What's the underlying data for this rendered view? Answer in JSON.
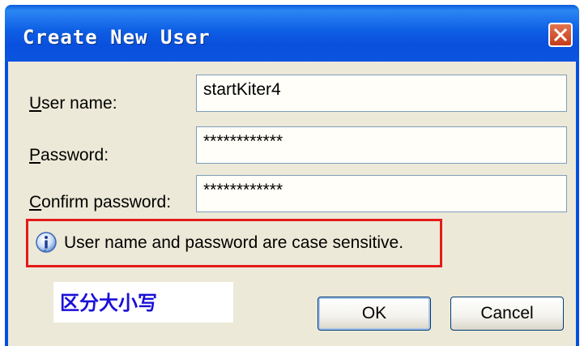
{
  "window": {
    "title": "Create New User"
  },
  "form": {
    "username": {
      "label_first": "U",
      "label_rest": "ser name:",
      "value": "startKiter4"
    },
    "password": {
      "label_first": "P",
      "label_rest": "assword:",
      "value": "************"
    },
    "confirm": {
      "label_first": "C",
      "label_rest": "onfirm password:",
      "value": "************"
    }
  },
  "notice": {
    "icon": "info-icon",
    "text": "User name and password are case sensitive.",
    "highlight_color": "#e41a1a"
  },
  "annotation": {
    "text": "区分大小写",
    "color": "#1a10d8"
  },
  "buttons": {
    "ok": "OK",
    "cancel": "Cancel"
  }
}
